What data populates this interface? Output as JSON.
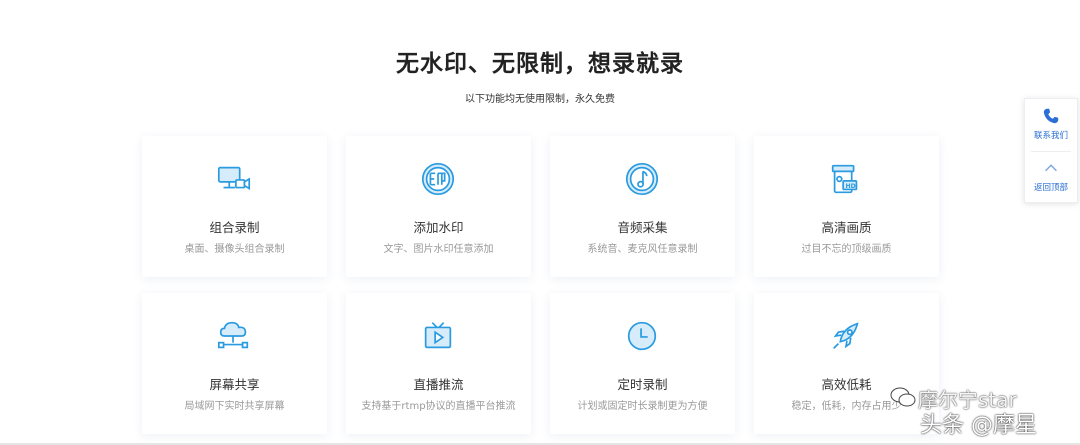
{
  "section": {
    "title": "无水印、无限制，想录就录",
    "subtitle": "以下功能均无使用限制，永久免费"
  },
  "features": [
    {
      "title": "组合录制",
      "desc": "桌面、摄像头组合录制",
      "icon": "desktop-camera-icon"
    },
    {
      "title": "添加水印",
      "desc": "文字、图片水印任意添加",
      "icon": "watermark-icon"
    },
    {
      "title": "音频采集",
      "desc": "系统音、麦克风任意录制",
      "icon": "music-note-icon"
    },
    {
      "title": "高清画质",
      "desc": "过目不忘的顶级画质",
      "icon": "hd-camera-icon"
    },
    {
      "title": "屏幕共享",
      "desc": "局域网下实时共享屏幕",
      "icon": "cloud-network-icon"
    },
    {
      "title": "直播推流",
      "desc": "支持基于rtmp协议的直播平台推流",
      "icon": "tv-play-icon"
    },
    {
      "title": "定时录制",
      "desc": "计划或固定时长录制更为方便",
      "icon": "clock-icon"
    },
    {
      "title": "高效低耗",
      "desc": "稳定，低耗，内存占用少",
      "icon": "rocket-icon"
    }
  ],
  "sidebar": {
    "contact_label": "联系我们",
    "top_label": "返回顶部"
  },
  "watermark": {
    "line1": "摩尔宁star",
    "line2": "头条 @摩星"
  },
  "colors": {
    "accent": "#2a9be0",
    "link": "#2b6fd6"
  }
}
